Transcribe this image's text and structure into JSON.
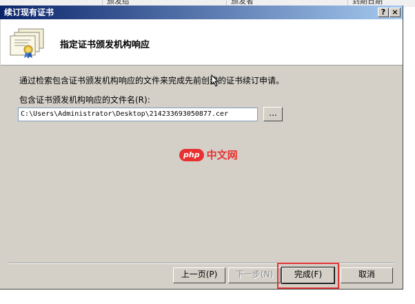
{
  "background": {
    "columns": [
      "颁发给",
      "颁发者",
      "到期日期"
    ]
  },
  "window": {
    "title": "续订现有证书",
    "help_label": "?",
    "close_label": "×"
  },
  "header": {
    "heading": "指定证书颁发机构响应"
  },
  "body": {
    "description": "通过检索包含证书颁发机构响应的文件来完成先前创建的证书续订申请。",
    "file_label": "包含证书颁发机构响应的文件名(R):",
    "file_value": "C:\\Users\\Administrator\\Desktop\\214233693050877.cer",
    "browse_label": "..."
  },
  "watermark": {
    "logo": "php",
    "text": "中文网"
  },
  "buttons": {
    "back": "上一页(P)",
    "next": "下一步(N)",
    "finish": "完成(F)",
    "cancel": "取消"
  },
  "colors": {
    "dialog_bg": "#d4d0c8",
    "title_start": "#0a246a",
    "title_end": "#a6caf0",
    "highlight": "#e03333",
    "watermark": "#e8312f"
  }
}
